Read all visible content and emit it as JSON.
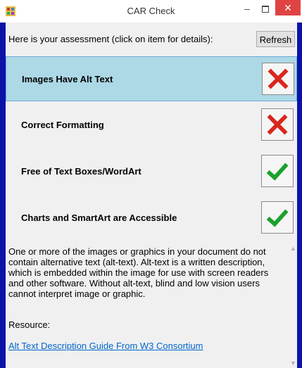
{
  "window": {
    "title": "CAR Check",
    "minimize_glyph": "–",
    "close_glyph": "✕"
  },
  "header": {
    "prompt": "Here is your assessment (click on item for details):",
    "refresh_label": "Refresh"
  },
  "items": [
    {
      "label": "Images Have Alt Text",
      "status": "fail",
      "selected": true
    },
    {
      "label": "Correct Formatting",
      "status": "fail",
      "selected": false
    },
    {
      "label": "Free of Text Boxes/WordArt",
      "status": "pass",
      "selected": false
    },
    {
      "label": "Charts and SmartArt are Accessible",
      "status": "pass",
      "selected": false
    }
  ],
  "details": {
    "description": "One or more of the images or graphics in your document do not contain alternative text (alt-text). Alt-text is a written description, which is embedded within the image for use with screen readers and other software. Without alt-text, blind and low vision users cannot interpret image or graphic.",
    "resource_label": "Resource:",
    "link_text": "Alt Text Description Guide From W3 Consortium"
  },
  "icons": {
    "fail": "x-mark-icon",
    "pass": "check-mark-icon"
  },
  "colors": {
    "background": "#0c12a8",
    "selected_row": "#add8e6",
    "fail": "#d9261c",
    "pass": "#1aa12b",
    "close_button": "#e04343",
    "link": "#0066cc"
  }
}
